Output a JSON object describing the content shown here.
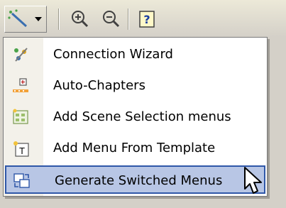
{
  "toolbar": {
    "buttons": [
      {
        "icon": "magic-wand-icon"
      },
      {
        "icon": "dropdown-arrow-icon"
      },
      {
        "icon": "zoom-in-icon"
      },
      {
        "icon": "zoom-out-icon"
      },
      {
        "icon": "help-icon"
      }
    ]
  },
  "menu": {
    "items": [
      {
        "label": "Connection Wizard",
        "icon": "connection-wizard-icon"
      },
      {
        "label": "Auto-Chapters",
        "icon": "auto-chapters-icon"
      },
      {
        "label": "Add Scene Selection menus",
        "icon": "scene-selection-icon"
      },
      {
        "label": "Add Menu From Template",
        "icon": "menu-template-icon"
      },
      {
        "label": "Generate Switched Menus",
        "icon": "switched-menus-icon",
        "highlighted": true
      }
    ]
  },
  "colors": {
    "highlight_fill": "#b8c6e5",
    "highlight_border": "#2f57a8"
  }
}
